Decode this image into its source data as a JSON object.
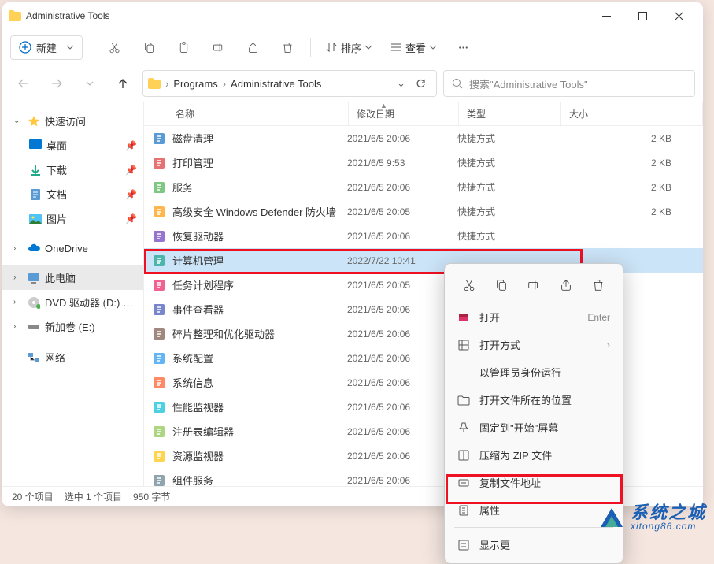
{
  "window": {
    "title": "Administrative Tools"
  },
  "toolbar": {
    "new": "新建",
    "sort": "排序",
    "view": "查看"
  },
  "address": {
    "crumbs": [
      "Programs",
      "Administrative Tools"
    ]
  },
  "search": {
    "placeholder": "搜索\"Administrative Tools\""
  },
  "sidebar": {
    "quick": "快速访问",
    "desktop": "桌面",
    "downloads": "下载",
    "documents": "文档",
    "pictures": "图片",
    "onedrive": "OneDrive",
    "thispc": "此电脑",
    "dvd": "DVD 驱动器 (D:) CO",
    "newvol": "新加卷 (E:)",
    "network": "网络"
  },
  "columns": {
    "name": "名称",
    "modified": "修改日期",
    "type": "类型",
    "size": "大小"
  },
  "files": [
    {
      "name": "磁盘清理",
      "date": "2021/6/5 20:06",
      "type": "快捷方式",
      "size": "2 KB"
    },
    {
      "name": "打印管理",
      "date": "2021/6/5 9:53",
      "type": "快捷方式",
      "size": "2 KB"
    },
    {
      "name": "服务",
      "date": "2021/6/5 20:06",
      "type": "快捷方式",
      "size": "2 KB"
    },
    {
      "name": "高级安全 Windows Defender 防火墙",
      "date": "2021/6/5 20:05",
      "type": "快捷方式",
      "size": "2 KB"
    },
    {
      "name": "恢复驱动器",
      "date": "2021/6/5 20:06",
      "type": "快捷方式",
      "size": ""
    },
    {
      "name": "计算机管理",
      "date": "2022/7/22 10:41",
      "type": "",
      "size": ""
    },
    {
      "name": "任务计划程序",
      "date": "2021/6/5 20:05",
      "type": "",
      "size": ""
    },
    {
      "name": "事件查看器",
      "date": "2021/6/5 20:06",
      "type": "",
      "size": ""
    },
    {
      "name": "碎片整理和优化驱动器",
      "date": "2021/6/5 20:06",
      "type": "",
      "size": ""
    },
    {
      "name": "系统配置",
      "date": "2021/6/5 20:06",
      "type": "",
      "size": ""
    },
    {
      "name": "系统信息",
      "date": "2021/6/5 20:06",
      "type": "",
      "size": ""
    },
    {
      "name": "性能监视器",
      "date": "2021/6/5 20:06",
      "type": "",
      "size": ""
    },
    {
      "name": "注册表编辑器",
      "date": "2021/6/5 20:06",
      "type": "",
      "size": ""
    },
    {
      "name": "资源监视器",
      "date": "2021/6/5 20:06",
      "type": "",
      "size": ""
    },
    {
      "name": "组件服务",
      "date": "2021/6/5 20:06",
      "type": "",
      "size": ""
    }
  ],
  "selectedIndex": 5,
  "status": {
    "items": "20 个项目",
    "sel": "选中 1 个项目",
    "size": "950 字节"
  },
  "ctx": {
    "open": "打开",
    "enter": "Enter",
    "openwith": "打开方式",
    "runas": "以管理员身份运行",
    "openloc": "打开文件所在的位置",
    "pinstart": "固定到\"开始\"屏幕",
    "zip": "压缩为 ZIP 文件",
    "copypath": "复制文件地址",
    "props": "属性",
    "more": "显示更"
  },
  "watermark": {
    "cn": "系统之城",
    "en": "xitong86.com"
  }
}
